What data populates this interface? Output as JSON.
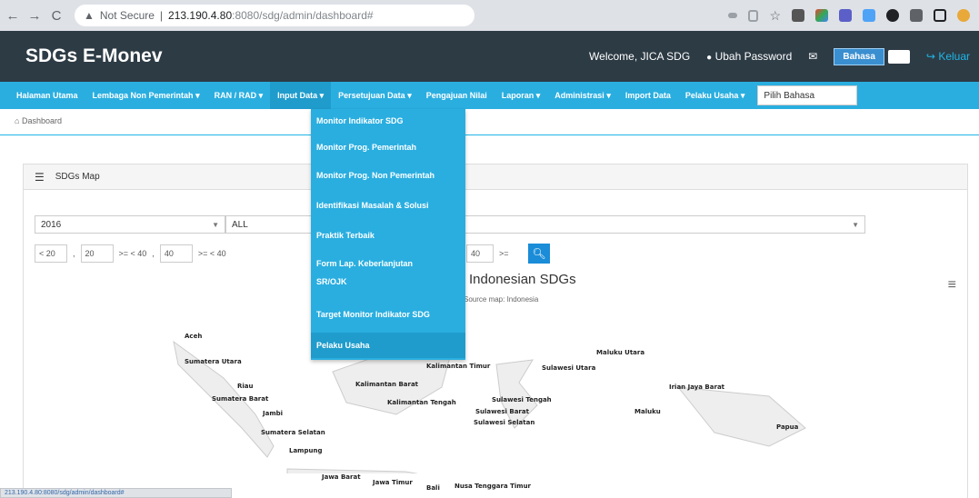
{
  "browser": {
    "not_secure": "Not Secure",
    "host": "213.190.4.80",
    "path": ":8080/sdg/admin/dashboard#"
  },
  "app": {
    "title": "SDGs E-Monev",
    "welcome": "Welcome, JICA SDG",
    "change_password": "Ubah Password",
    "language_button": "Bahasa",
    "logout": "Keluar"
  },
  "nav": {
    "items": [
      "Halaman Utama",
      "Lembaga Non Pemerintah",
      "RAN / RAD",
      "Input Data",
      "Persetujuan Data",
      "Pengajuan Nilai",
      "Laporan",
      "Administrasi",
      "Import Data",
      "Pelaku Usaha"
    ],
    "language_placeholder": "Pilih Bahasa"
  },
  "breadcrumb": "Dashboard",
  "dropdown": {
    "items": [
      "Monitor Indikator SDG",
      "Monitor Prog. Pemerintah",
      "Monitor Prog. Non Pemerintah",
      "Identifikasi Masalah & Solusi",
      "Praktik Terbaik",
      "Form Lap. Keberlanjutan",
      "SR/OJK",
      "Target Monitor Indikator SDG",
      "Pelaku Usaha"
    ]
  },
  "panel": {
    "title": "SDGs Map",
    "year": "2016",
    "filter": "ALL",
    "range": {
      "lt1": "< 20",
      "a": "20",
      "b": ">= < 40",
      "c": "40",
      "d": ">= < 40",
      "e": "40",
      "f": ">="
    }
  },
  "map": {
    "title": "Indonesian SDGs",
    "subtitle": "Source map: Indonesia",
    "regions": [
      "Aceh",
      "Sumatera Utara",
      "Riau",
      "Sumatera Barat",
      "Jambi",
      "Sumatera Selatan",
      "Lampung",
      "Jawa Barat",
      "Jawa Timur",
      "Bali",
      "Nusa Tenggara Timur",
      "Kalimantan Barat",
      "Kalimantan Tengah",
      "Kalimantan Timur",
      "Sulawesi Utara",
      "Sulawesi Tengah",
      "Sulawesi Barat",
      "Sulawesi Selatan",
      "Maluku Utara",
      "Maluku",
      "Irian Jaya Barat",
      "Papua"
    ]
  },
  "status_url": "213.190.4.80:8080/sdg/admin/dashboard#"
}
